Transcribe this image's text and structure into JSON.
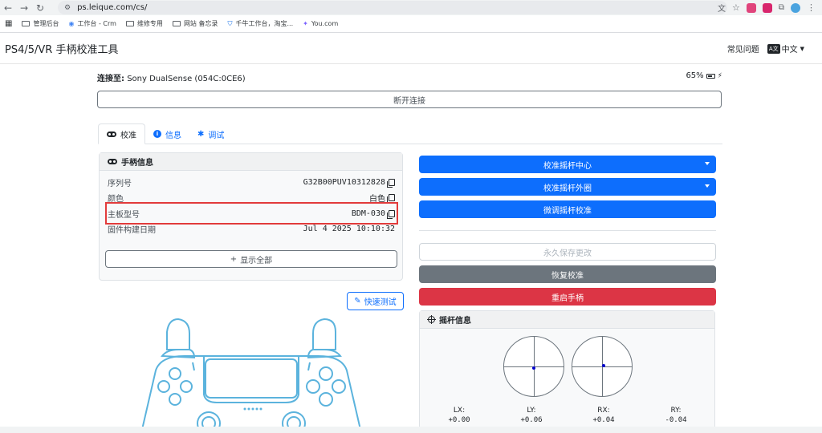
{
  "browser": {
    "url": "ps.leique.com/cs/",
    "bookmarks": [
      "管理后台",
      "工作台 - Crm",
      "维修专用",
      "网站 备忘录",
      "千牛工作台，淘宝...",
      "You.com"
    ]
  },
  "header": {
    "title": "PS4/5/VR 手柄校准工具",
    "faq_label": "常见问题",
    "language_label": "中文"
  },
  "connection": {
    "label": "连接至:",
    "device": "Sony DualSense (054C:0CE6)",
    "battery": "65%",
    "disconnect_label": "断开连接"
  },
  "tabs": [
    {
      "label": "校准",
      "active": true
    },
    {
      "label": "信息",
      "active": false
    },
    {
      "label": "调试",
      "active": false
    }
  ],
  "controller_info": {
    "title": "手柄信息",
    "rows": [
      {
        "key": "序列号",
        "value": "G32B00PUV10312828"
      },
      {
        "key": "颜色",
        "value": "白色"
      },
      {
        "key": "主板型号",
        "value": "BDM-030"
      },
      {
        "key": "固件构建日期",
        "value": "Jul 4 2025 10:10:32"
      }
    ],
    "show_all_label": "显示全部"
  },
  "quick_test_label": "快速测试",
  "actions": {
    "calibrate_center": "校准摇杆中心",
    "calibrate_range": "校准摇杆外圈",
    "fine_tune": "微调摇杆校准",
    "save_permanent": "永久保存更改",
    "restore": "恢复校准",
    "reboot": "重启手柄"
  },
  "stick_info": {
    "title": "摇杆信息",
    "axes": [
      {
        "label": "LX:",
        "value": "+0.00"
      },
      {
        "label": "LY:",
        "value": "+0.06"
      },
      {
        "label": "RX:",
        "value": "+0.04"
      },
      {
        "label": "RY:",
        "value": "-0.04"
      }
    ]
  },
  "colors": {
    "primary": "#0d6efd",
    "secondary": "#6c757d",
    "danger": "#dc3545",
    "highlight": "#e23b3b",
    "controller_outline": "#5bb3dd"
  }
}
